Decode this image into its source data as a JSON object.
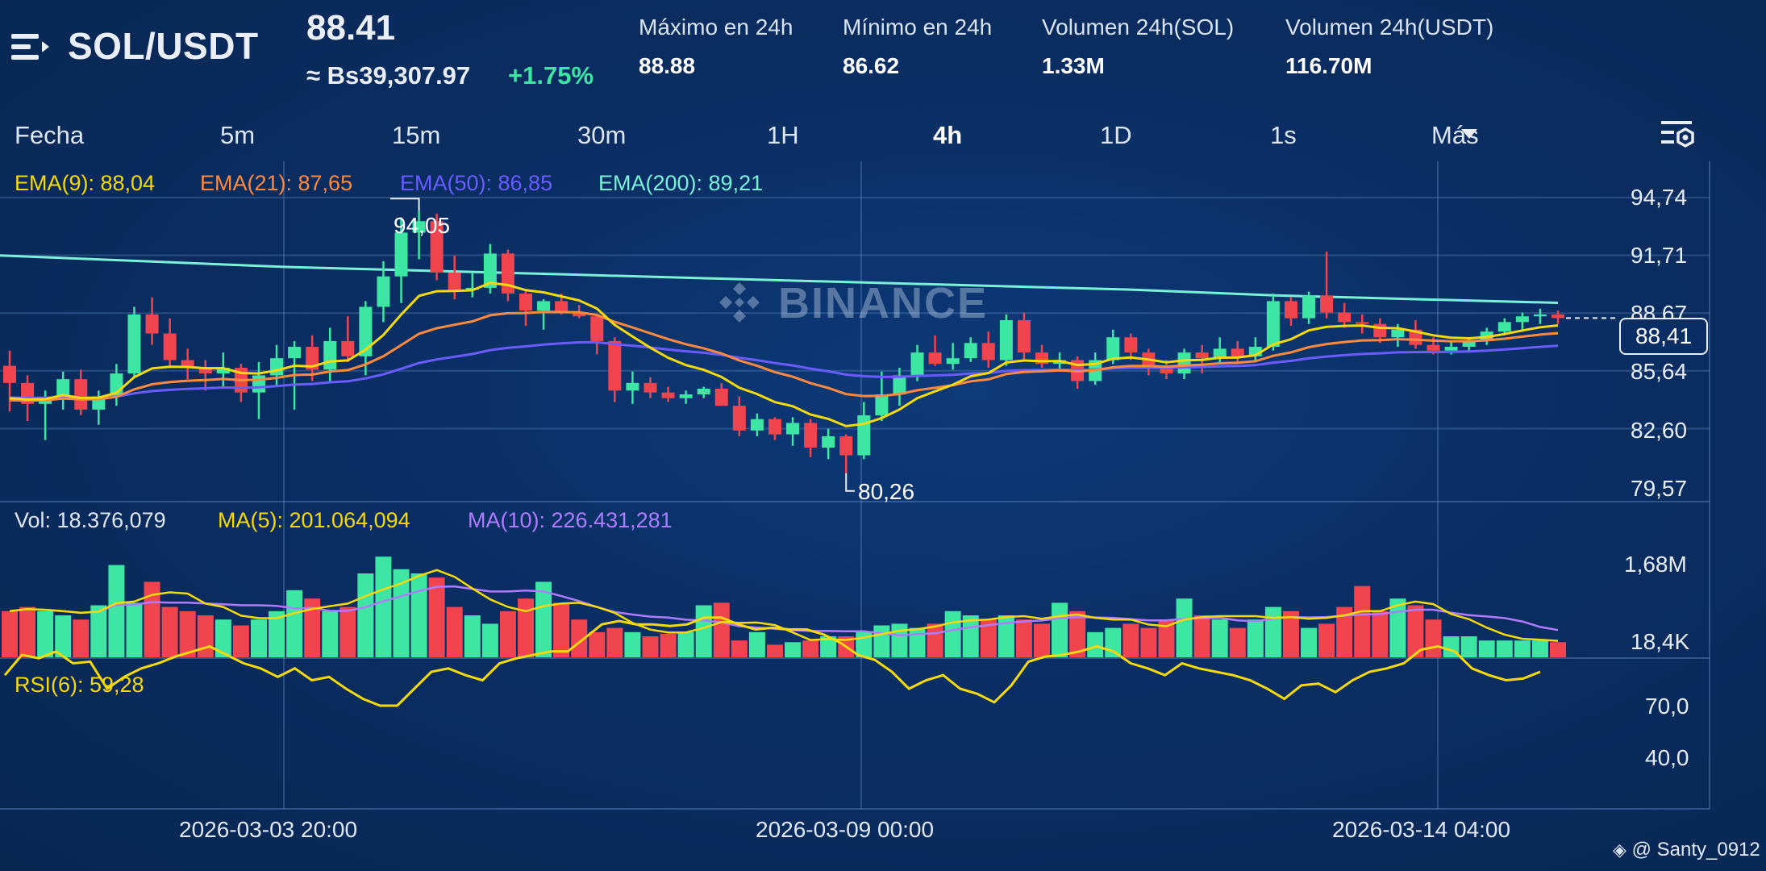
{
  "header": {
    "pair": "SOL/USDT",
    "price": "88.41",
    "price_fiat": "≈ Bs39,307.97",
    "change": "+1.75%",
    "stats": [
      {
        "label": "Máximo en 24h",
        "value": "88.88"
      },
      {
        "label": "Mínimo en 24h",
        "value": "86.62"
      },
      {
        "label": "Volumen 24h(SOL)",
        "value": "1.33M"
      },
      {
        "label": "Volumen 24h(USDT)",
        "value": "116.70M"
      }
    ]
  },
  "tabs": [
    "Fecha",
    "5m",
    "15m",
    "30m",
    "1H",
    "4h",
    "1D",
    "1s",
    "Más"
  ],
  "active_tab": "4h",
  "indicators": {
    "ema9": "EMA(9): 88,04",
    "ema21": "EMA(21): 87,65",
    "ema50": "EMA(50): 86,85",
    "ema200": "EMA(200): 89,21",
    "vol": "Vol: 18.376,079",
    "ma5": "MA(5): 201.064,094",
    "ma10": "MA(10): 226.431,281",
    "rsi": "RSI(6): 59,28"
  },
  "colors": {
    "up": "#3ee6a4",
    "down": "#f0454f",
    "ema9": "#f5d90a",
    "ema21": "#ff8a3d",
    "ema50": "#6a5cff",
    "ema200": "#7df0d9",
    "ma5": "#f5d90a",
    "ma10": "#b07cff",
    "rsi": "#f5d90a"
  },
  "watermark": "BINANCE",
  "current_price_tag": "88,41",
  "price_axis": [
    "94,74",
    "91,71",
    "88,67",
    "85,64",
    "82,60",
    "79,57"
  ],
  "volume_axis": [
    "1,68M",
    "18,4K"
  ],
  "rsi_axis": [
    "70,0",
    "40,0"
  ],
  "high_marker": "94,05",
  "low_marker": "80,26",
  "date_labels": [
    "2026-03-03 20:00",
    "2026-03-09 00:00",
    "2026-03-14 04:00"
  ],
  "credit": "@ Santy_0912",
  "chart_data": {
    "type": "candlestick",
    "x_labels": [
      "2026-03-03 20:00",
      "2026-03-09 00:00",
      "2026-03-14 04:00"
    ],
    "price_range": [
      79.57,
      94.74
    ],
    "high": 94.05,
    "low": 80.26,
    "last": 88.41,
    "candles": [
      {
        "o": 85.9,
        "h": 86.7,
        "l": 83.5,
        "c": 85.0
      },
      {
        "o": 85.0,
        "h": 85.4,
        "l": 83.0,
        "c": 83.9
      },
      {
        "o": 83.9,
        "h": 84.6,
        "l": 82.0,
        "c": 84.2
      },
      {
        "o": 84.2,
        "h": 85.6,
        "l": 83.6,
        "c": 85.2
      },
      {
        "o": 85.2,
        "h": 85.7,
        "l": 83.3,
        "c": 83.6
      },
      {
        "o": 83.6,
        "h": 84.6,
        "l": 82.8,
        "c": 84.3
      },
      {
        "o": 84.3,
        "h": 86.0,
        "l": 83.8,
        "c": 85.5
      },
      {
        "o": 85.5,
        "h": 89.0,
        "l": 85.3,
        "c": 88.6
      },
      {
        "o": 88.6,
        "h": 89.5,
        "l": 87.0,
        "c": 87.6
      },
      {
        "o": 87.6,
        "h": 88.4,
        "l": 85.9,
        "c": 86.2
      },
      {
        "o": 86.2,
        "h": 86.8,
        "l": 85.2,
        "c": 85.8
      },
      {
        "o": 85.8,
        "h": 86.2,
        "l": 84.6,
        "c": 85.5
      },
      {
        "o": 85.5,
        "h": 86.6,
        "l": 84.8,
        "c": 85.8
      },
      {
        "o": 85.8,
        "h": 86.0,
        "l": 84.0,
        "c": 84.5
      },
      {
        "o": 84.5,
        "h": 86.1,
        "l": 83.1,
        "c": 85.4
      },
      {
        "o": 85.4,
        "h": 87.0,
        "l": 84.8,
        "c": 86.3
      },
      {
        "o": 86.3,
        "h": 87.2,
        "l": 83.6,
        "c": 86.9
      },
      {
        "o": 86.9,
        "h": 87.5,
        "l": 85.1,
        "c": 85.7
      },
      {
        "o": 85.7,
        "h": 87.9,
        "l": 85.0,
        "c": 87.2
      },
      {
        "o": 87.2,
        "h": 88.5,
        "l": 86.1,
        "c": 86.4
      },
      {
        "o": 86.4,
        "h": 89.3,
        "l": 85.4,
        "c": 89.0
      },
      {
        "o": 89.0,
        "h": 91.4,
        "l": 88.2,
        "c": 90.6
      },
      {
        "o": 90.6,
        "h": 93.7,
        "l": 89.2,
        "c": 92.9
      },
      {
        "o": 92.9,
        "h": 94.05,
        "l": 91.5,
        "c": 93.5
      },
      {
        "o": 93.5,
        "h": 93.9,
        "l": 90.4,
        "c": 90.8
      },
      {
        "o": 90.8,
        "h": 91.7,
        "l": 89.4,
        "c": 89.9
      },
      {
        "o": 89.9,
        "h": 90.8,
        "l": 89.5,
        "c": 90.0
      },
      {
        "o": 90.0,
        "h": 92.3,
        "l": 89.7,
        "c": 91.8
      },
      {
        "o": 91.8,
        "h": 92.0,
        "l": 89.3,
        "c": 89.7
      },
      {
        "o": 89.7,
        "h": 89.9,
        "l": 88.0,
        "c": 88.8
      },
      {
        "o": 88.8,
        "h": 89.4,
        "l": 87.8,
        "c": 89.3
      },
      {
        "o": 89.3,
        "h": 89.7,
        "l": 88.6,
        "c": 88.7
      },
      {
        "o": 88.7,
        "h": 89.1,
        "l": 88.4,
        "c": 88.5
      },
      {
        "o": 88.5,
        "h": 88.6,
        "l": 86.5,
        "c": 87.2
      },
      {
        "o": 87.2,
        "h": 87.4,
        "l": 84.0,
        "c": 84.6
      },
      {
        "o": 84.6,
        "h": 85.6,
        "l": 83.9,
        "c": 85.0
      },
      {
        "o": 85.0,
        "h": 85.3,
        "l": 84.2,
        "c": 84.5
      },
      {
        "o": 84.5,
        "h": 84.8,
        "l": 84.0,
        "c": 84.2
      },
      {
        "o": 84.2,
        "h": 84.6,
        "l": 83.9,
        "c": 84.4
      },
      {
        "o": 84.4,
        "h": 84.8,
        "l": 84.2,
        "c": 84.7
      },
      {
        "o": 84.7,
        "h": 85.0,
        "l": 83.8,
        "c": 83.8
      },
      {
        "o": 83.8,
        "h": 84.3,
        "l": 82.2,
        "c": 82.5
      },
      {
        "o": 82.5,
        "h": 83.4,
        "l": 82.2,
        "c": 83.1
      },
      {
        "o": 83.1,
        "h": 83.2,
        "l": 82.0,
        "c": 82.3
      },
      {
        "o": 82.3,
        "h": 83.2,
        "l": 81.7,
        "c": 82.9
      },
      {
        "o": 82.9,
        "h": 83.1,
        "l": 81.1,
        "c": 81.6
      },
      {
        "o": 81.6,
        "h": 82.6,
        "l": 81.0,
        "c": 82.2
      },
      {
        "o": 82.2,
        "h": 82.3,
        "l": 80.26,
        "c": 81.2
      },
      {
        "o": 81.2,
        "h": 84.0,
        "l": 81.0,
        "c": 83.3
      },
      {
        "o": 83.3,
        "h": 85.6,
        "l": 83.0,
        "c": 84.4
      },
      {
        "o": 84.4,
        "h": 85.8,
        "l": 83.8,
        "c": 85.4
      },
      {
        "o": 85.4,
        "h": 87.0,
        "l": 85.1,
        "c": 86.6
      },
      {
        "o": 86.6,
        "h": 87.5,
        "l": 85.9,
        "c": 86.0
      },
      {
        "o": 86.0,
        "h": 87.1,
        "l": 85.7,
        "c": 86.3
      },
      {
        "o": 86.3,
        "h": 87.4,
        "l": 86.1,
        "c": 87.1
      },
      {
        "o": 87.1,
        "h": 87.7,
        "l": 85.8,
        "c": 86.2
      },
      {
        "o": 86.2,
        "h": 88.6,
        "l": 85.9,
        "c": 88.3
      },
      {
        "o": 88.3,
        "h": 88.7,
        "l": 86.2,
        "c": 86.6
      },
      {
        "o": 86.6,
        "h": 87.0,
        "l": 85.8,
        "c": 86.0
      },
      {
        "o": 86.0,
        "h": 86.6,
        "l": 85.6,
        "c": 86.2
      },
      {
        "o": 86.2,
        "h": 86.4,
        "l": 84.7,
        "c": 85.1
      },
      {
        "o": 85.1,
        "h": 86.6,
        "l": 84.9,
        "c": 86.2
      },
      {
        "o": 86.2,
        "h": 87.8,
        "l": 86.0,
        "c": 87.4
      },
      {
        "o": 87.4,
        "h": 87.6,
        "l": 86.2,
        "c": 86.6
      },
      {
        "o": 86.6,
        "h": 86.8,
        "l": 85.4,
        "c": 85.8
      },
      {
        "o": 85.8,
        "h": 86.2,
        "l": 85.2,
        "c": 85.5
      },
      {
        "o": 85.5,
        "h": 86.8,
        "l": 85.2,
        "c": 86.6
      },
      {
        "o": 86.6,
        "h": 87.0,
        "l": 85.5,
        "c": 86.3
      },
      {
        "o": 86.3,
        "h": 87.4,
        "l": 86.0,
        "c": 86.8
      },
      {
        "o": 86.8,
        "h": 87.2,
        "l": 86.0,
        "c": 86.4
      },
      {
        "o": 86.4,
        "h": 87.4,
        "l": 86.1,
        "c": 86.9
      },
      {
        "o": 86.9,
        "h": 89.7,
        "l": 86.7,
        "c": 89.3
      },
      {
        "o": 89.3,
        "h": 89.5,
        "l": 88.0,
        "c": 88.4
      },
      {
        "o": 88.4,
        "h": 89.8,
        "l": 88.1,
        "c": 89.6
      },
      {
        "o": 89.6,
        "h": 91.9,
        "l": 88.4,
        "c": 88.7
      },
      {
        "o": 88.7,
        "h": 89.2,
        "l": 87.9,
        "c": 88.2
      },
      {
        "o": 88.2,
        "h": 88.6,
        "l": 87.6,
        "c": 88.1
      },
      {
        "o": 88.1,
        "h": 88.4,
        "l": 87.1,
        "c": 87.4
      },
      {
        "o": 87.4,
        "h": 88.1,
        "l": 86.9,
        "c": 87.8
      },
      {
        "o": 87.8,
        "h": 88.3,
        "l": 86.8,
        "c": 87.0
      },
      {
        "o": 87.0,
        "h": 87.4,
        "l": 86.5,
        "c": 86.7
      },
      {
        "o": 86.7,
        "h": 87.2,
        "l": 86.5,
        "c": 86.9
      },
      {
        "o": 86.9,
        "h": 87.3,
        "l": 86.6,
        "c": 87.2
      },
      {
        "o": 87.2,
        "h": 87.9,
        "l": 87.0,
        "c": 87.7
      },
      {
        "o": 87.7,
        "h": 88.4,
        "l": 87.5,
        "c": 88.2
      },
      {
        "o": 88.2,
        "h": 88.7,
        "l": 87.7,
        "c": 88.5
      },
      {
        "o": 88.5,
        "h": 88.9,
        "l": 88.1,
        "c": 88.6
      },
      {
        "o": 88.6,
        "h": 88.8,
        "l": 88.1,
        "c": 88.41
      }
    ],
    "ema200": [
      91.7,
      91.4,
      91.1,
      90.9,
      90.7,
      90.5,
      90.3,
      90.1,
      89.9,
      89.6,
      89.4,
      89.21
    ],
    "volume": [
      0.55,
      0.6,
      0.55,
      0.5,
      0.45,
      0.62,
      1.1,
      0.65,
      0.9,
      0.6,
      0.55,
      0.5,
      0.45,
      0.38,
      0.45,
      0.55,
      0.8,
      0.7,
      0.55,
      0.6,
      1.0,
      1.2,
      1.05,
      1.0,
      0.95,
      0.6,
      0.5,
      0.4,
      0.55,
      0.7,
      0.9,
      0.65,
      0.45,
      0.3,
      0.35,
      0.3,
      0.25,
      0.28,
      0.3,
      0.62,
      0.65,
      0.2,
      0.3,
      0.15,
      0.18,
      0.2,
      0.25,
      0.25,
      0.3,
      0.38,
      0.4,
      0.35,
      0.4,
      0.55,
      0.5,
      0.45,
      0.5,
      0.45,
      0.4,
      0.65,
      0.55,
      0.3,
      0.35,
      0.4,
      0.35,
      0.45,
      0.7,
      0.5,
      0.45,
      0.35,
      0.45,
      0.6,
      0.55,
      0.35,
      0.4,
      0.6,
      0.85,
      0.55,
      0.7,
      0.62,
      0.45,
      0.25,
      0.25,
      0.2,
      0.2,
      0.2,
      0.2,
      0.18
    ],
    "rsi": [
      52,
      40,
      42,
      38,
      45,
      44,
      60,
      53,
      48,
      45,
      41,
      38,
      35,
      40,
      45,
      48,
      53,
      48,
      55,
      53,
      60,
      66,
      70,
      70,
      60,
      50,
      48,
      52,
      55,
      45,
      42,
      40,
      38,
      38,
      30,
      22,
      20,
      22,
      22,
      23,
      22,
      18,
      18,
      22,
      25,
      24,
      25,
      25,
      28,
      33,
      40,
      43,
      50,
      60,
      55,
      52,
      60,
      63,
      68,
      58,
      44,
      41,
      40,
      38,
      35,
      38,
      45,
      48,
      52,
      45,
      48,
      50,
      52,
      55,
      60,
      66,
      58,
      57,
      62,
      55,
      50,
      48,
      45,
      37,
      35,
      38,
      48,
      52,
      55,
      54,
      50
    ]
  }
}
